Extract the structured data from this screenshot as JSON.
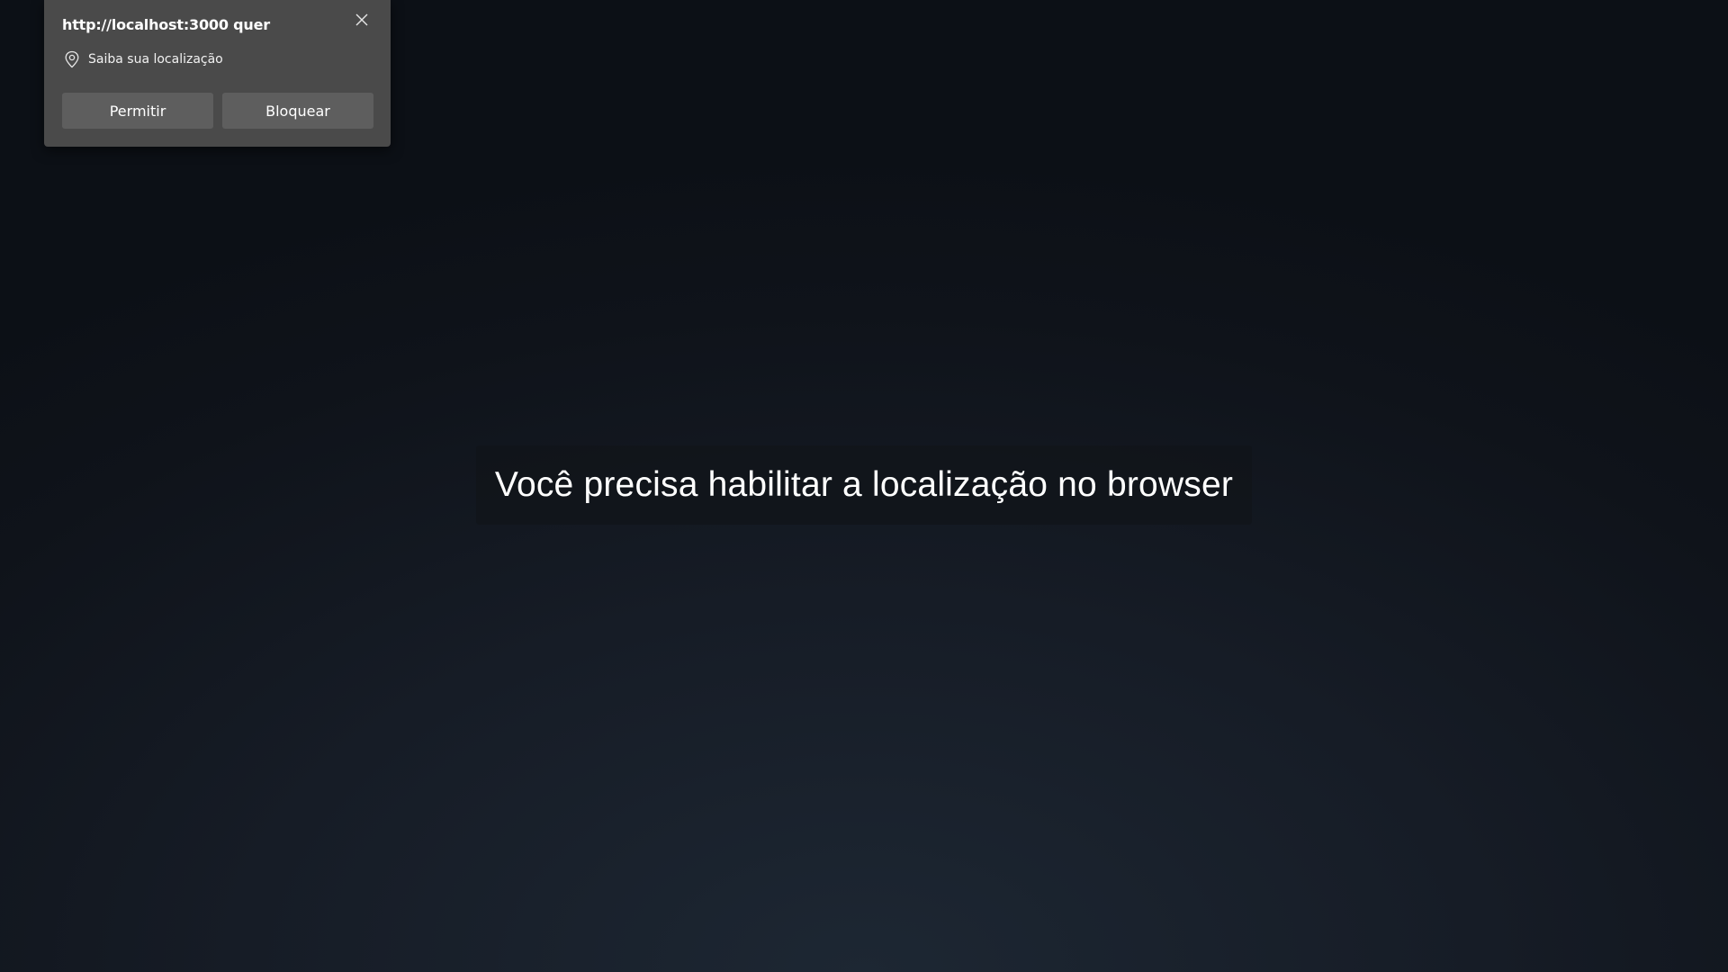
{
  "page": {
    "message": "Você precisa habilitar a localização no browser"
  },
  "permission_prompt": {
    "title": "http://localhost:3000 quer",
    "permission_icon": "location-pin-icon",
    "permission_label": "Saiba sua localização",
    "close_icon": "close-icon",
    "allow_label": "Permitir",
    "block_label": "Bloquear"
  },
  "colors": {
    "popup_background": "#4a4a4a",
    "button_background": "#5e5e5e",
    "page_background": "#161c26",
    "text": "#ffffff"
  }
}
